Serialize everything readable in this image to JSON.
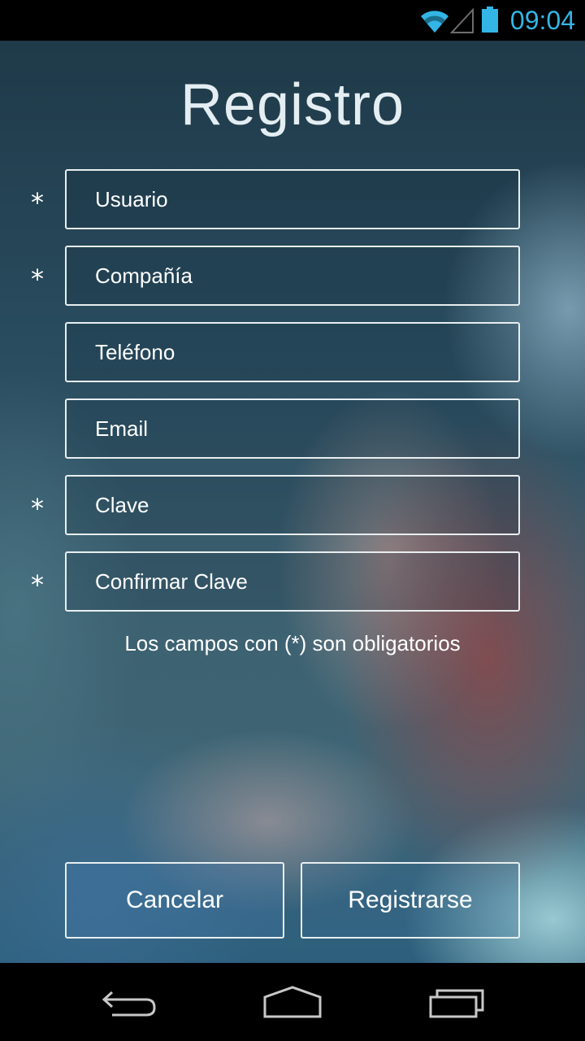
{
  "status_bar": {
    "time": "09:04",
    "icons": [
      "wifi-icon",
      "signal-icon",
      "battery-icon"
    ],
    "accent_color": "#33b5e5"
  },
  "screen": {
    "title": "Registro"
  },
  "form": {
    "fields": [
      {
        "placeholder": "Usuario",
        "required": true,
        "required_mark": "*"
      },
      {
        "placeholder": "Compañía",
        "required": true,
        "required_mark": "*"
      },
      {
        "placeholder": "Teléfono",
        "required": false,
        "required_mark": ""
      },
      {
        "placeholder": "Email",
        "required": false,
        "required_mark": ""
      },
      {
        "placeholder": "Clave",
        "required": true,
        "required_mark": "*"
      },
      {
        "placeholder": "Confirmar Clave",
        "required": true,
        "required_mark": "*"
      }
    ],
    "hint": "Los campos con (*) son obligatorios"
  },
  "actions": {
    "cancel_label": "Cancelar",
    "register_label": "Registrarse"
  },
  "nav_bar": {
    "icons": [
      "back-icon",
      "home-icon",
      "recents-icon"
    ]
  }
}
